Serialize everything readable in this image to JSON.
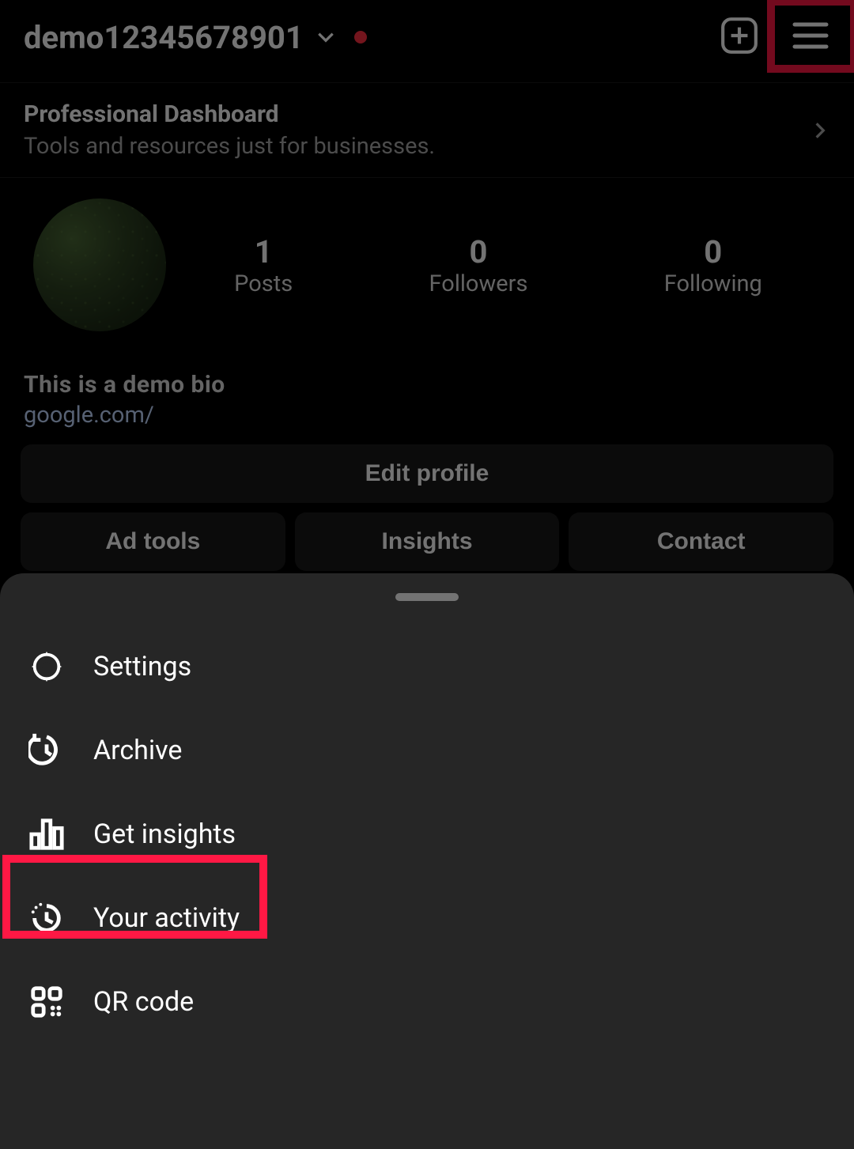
{
  "header": {
    "username": "demo12345678901"
  },
  "dashboard": {
    "title": "Professional Dashboard",
    "subtitle": "Tools and resources just for businesses."
  },
  "stats": {
    "posts": {
      "count": "1",
      "label": "Posts"
    },
    "followers": {
      "count": "0",
      "label": "Followers"
    },
    "following": {
      "count": "0",
      "label": "Following"
    }
  },
  "bio": {
    "text": "This is a demo bio",
    "link": "google.com/"
  },
  "buttons": {
    "edit": "Edit profile",
    "adtools": "Ad tools",
    "insights": "Insights",
    "contact": "Contact"
  },
  "menu": {
    "settings": "Settings",
    "archive": "Archive",
    "getinsights": "Get insights",
    "activity": "Your activity",
    "qrcode": "QR code"
  }
}
